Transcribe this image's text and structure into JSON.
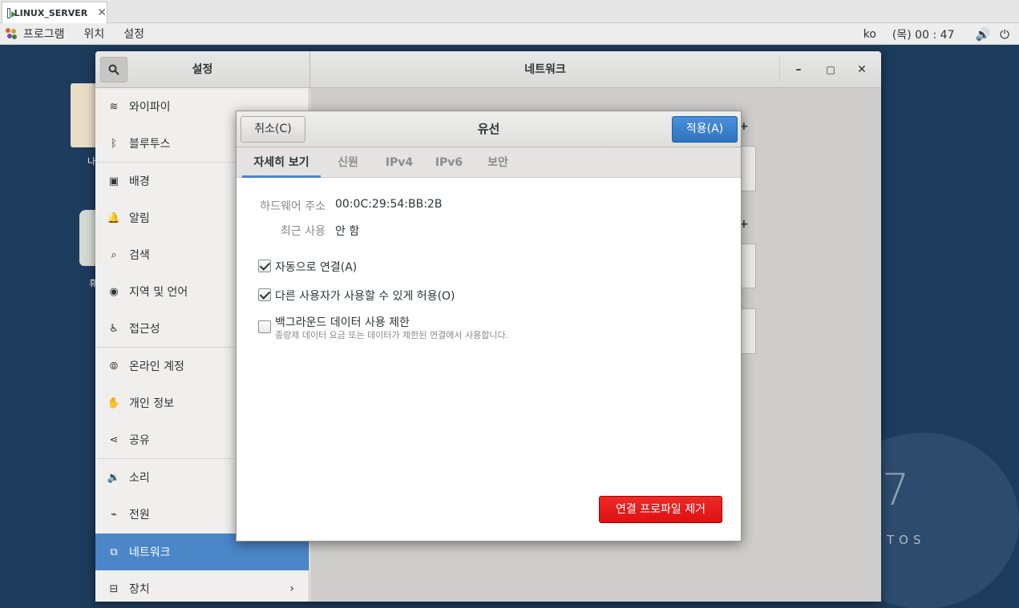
{
  "vm_tab": {
    "title": "LINUX_SERVER",
    "close": "✕"
  },
  "topbar": {
    "menus": [
      "프로그램",
      "위치",
      "설정"
    ],
    "lang": "ko",
    "clock": "(목) 00 : 47",
    "volume_icon": "🔊",
    "power_icon": "⏻"
  },
  "desktop": {
    "folder_label": "나",
    "trash_label": "휴",
    "brand_number": "7",
    "brand_text": "TOS"
  },
  "settings": {
    "sidebar_title": "설정",
    "main_title": "네트워크",
    "window_controls": {
      "minimize": "–",
      "maximize": "□",
      "close": "✕"
    },
    "sidebar_items": [
      {
        "label": "와이파이",
        "icon": "wifi-icon",
        "glyph": "≋"
      },
      {
        "label": "블루투스",
        "icon": "bluetooth-icon",
        "glyph": "ᛒ"
      },
      {
        "label": "배경",
        "icon": "background-icon",
        "glyph": "▣"
      },
      {
        "label": "알림",
        "icon": "bell-icon",
        "glyph": "🔔"
      },
      {
        "label": "검색",
        "icon": "search-icon",
        "glyph": "⌕"
      },
      {
        "label": "지역 및 언어",
        "icon": "region-icon",
        "glyph": "◉"
      },
      {
        "label": "접근성",
        "icon": "accessibility-icon",
        "glyph": "♿"
      },
      {
        "label": "온라인 계정",
        "icon": "online-accounts-icon",
        "glyph": "⦾"
      },
      {
        "label": "개인 정보",
        "icon": "privacy-hand-icon",
        "glyph": "✋"
      },
      {
        "label": "공유",
        "icon": "share-icon",
        "glyph": "⋖"
      },
      {
        "label": "소리",
        "icon": "sound-icon",
        "glyph": "🔉"
      },
      {
        "label": "전원",
        "icon": "power-plug-icon",
        "glyph": "⌁"
      },
      {
        "label": "네트워크",
        "icon": "network-icon",
        "glyph": "⧉"
      },
      {
        "label": "장치",
        "icon": "devices-icon",
        "glyph": "⊟"
      }
    ],
    "devices_chevron": "›"
  },
  "dialog": {
    "cancel_label": "취소(C)",
    "title": "유선",
    "apply_label": "적용(A)",
    "tabs": [
      "자세히 보기",
      "신원",
      "IPv4",
      "IPv6",
      "보안"
    ],
    "active_tab": 0,
    "hardware_address_label": "하드웨어 주소",
    "hardware_address_value": "00:0C:29:54:BB:2B",
    "last_used_label": "최근 사용",
    "last_used_value": "안 함",
    "options": [
      {
        "label": "자동으로 연결(A)",
        "checked": true
      },
      {
        "label": "다른 사용자가 사용할 수 있게 허용(O)",
        "checked": true
      },
      {
        "label": "백그라운드 데이터 사용 제한",
        "checked": false,
        "sub": "종량제 데이터 요금 또는 데이터가 제한된 연결에서 사용합니다."
      }
    ],
    "remove_label": "연결 프로파일 제거"
  },
  "colors": {
    "accent": "#4a86c8",
    "apply": "#3a7fcc",
    "destructive": "#e01b1b"
  }
}
